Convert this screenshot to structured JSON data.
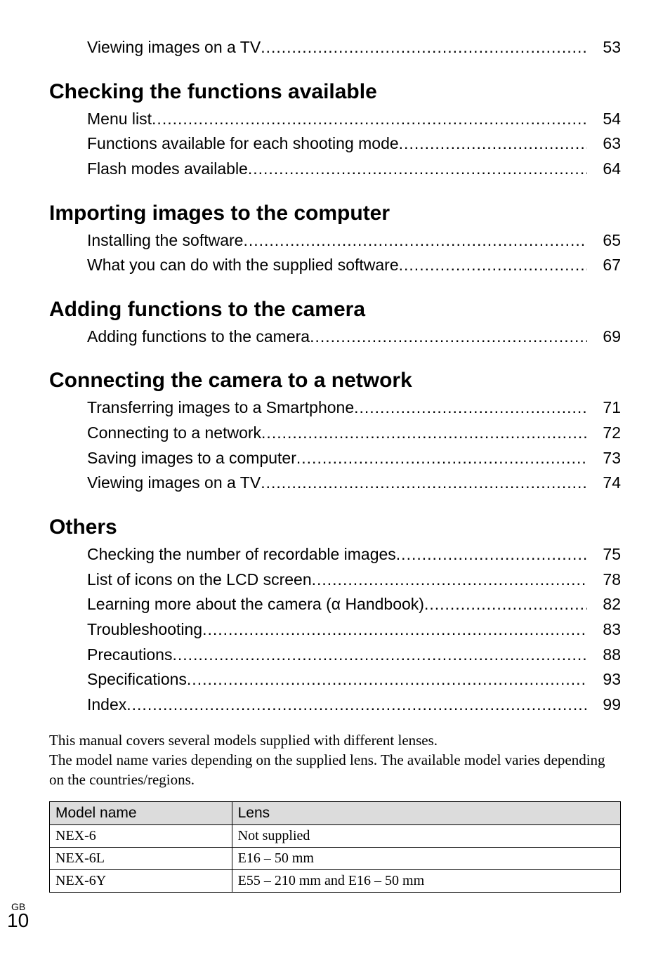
{
  "topEntry": {
    "label": "Viewing images on a TV",
    "page": "53"
  },
  "sections": [
    {
      "heading": "Checking the functions available",
      "items": [
        {
          "label": "Menu list",
          "page": "54"
        },
        {
          "label": "Functions available for each shooting mode",
          "page": "63"
        },
        {
          "label": "Flash modes available",
          "page": "64"
        }
      ]
    },
    {
      "heading": "Importing images to the computer",
      "items": [
        {
          "label": "Installing the software",
          "page": "65"
        },
        {
          "label": "What you can do with the supplied software",
          "page": "67"
        }
      ]
    },
    {
      "heading": "Adding functions to the camera",
      "items": [
        {
          "label": "Adding functions to the camera",
          "page": "69"
        }
      ]
    },
    {
      "heading": "Connecting the camera to a network",
      "items": [
        {
          "label": "Transferring images to a Smartphone",
          "page": "71"
        },
        {
          "label": "Connecting to a network",
          "page": "72"
        },
        {
          "label": "Saving images to a computer",
          "page": "73"
        },
        {
          "label": "Viewing images on a TV",
          "page": "74"
        }
      ]
    },
    {
      "heading": "Others",
      "items": [
        {
          "label": "Checking the number of recordable images",
          "page": "75"
        },
        {
          "label": "List of icons on the LCD screen",
          "page": "78"
        },
        {
          "label": "Learning more about the camera (α Handbook)",
          "page": "82"
        },
        {
          "label": "Troubleshooting",
          "page": "83"
        },
        {
          "label": "Precautions",
          "page": "88"
        },
        {
          "label": "Specifications",
          "page": "93"
        },
        {
          "label": "Index",
          "page": "99"
        }
      ]
    }
  ],
  "note": {
    "line1": "This manual covers several models supplied with different lenses.",
    "line2": "The model name varies depending on the supplied lens. The available model varies depending on the countries/regions."
  },
  "tableHeaders": {
    "model": "Model name",
    "lens": "Lens"
  },
  "tableRows": [
    {
      "model": "NEX-6",
      "lens": "Not supplied"
    },
    {
      "model": "NEX-6L",
      "lens": "E16 – 50 mm"
    },
    {
      "model": "NEX-6Y",
      "lens": "E55 – 210 mm and E16 – 50 mm"
    }
  ],
  "footer": {
    "region": "GB",
    "pageNumber": "10"
  }
}
